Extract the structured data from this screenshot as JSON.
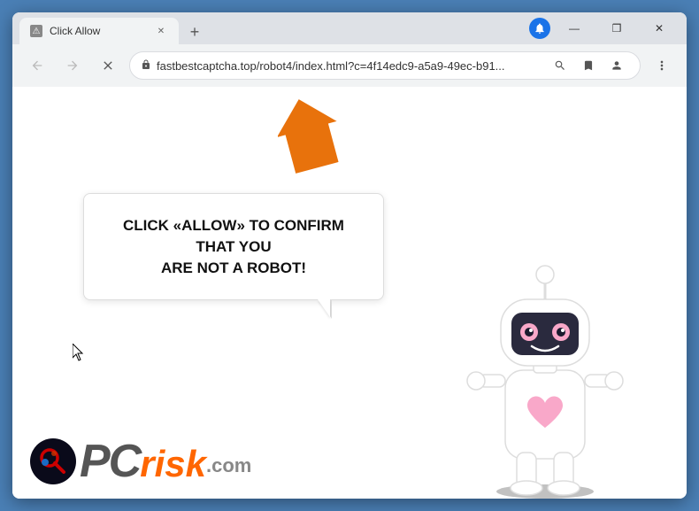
{
  "browser": {
    "tab": {
      "title": "Click Allow",
      "favicon": "⚠"
    },
    "new_tab_label": "+",
    "window_controls": {
      "minimize": "—",
      "maximize": "❒",
      "close": "✕"
    },
    "notification_icon": "🔔"
  },
  "navbar": {
    "back_label": "←",
    "forward_label": "→",
    "reload_label": "✕",
    "url": "fastbestcaptcha.top/robot4/index.html?c=4f14edc9-a5a9-49ec-b91...",
    "lock_icon": "🔒",
    "search_icon": "🔍",
    "bookmark_icon": "☆",
    "profile_icon": "👤",
    "menu_icon": "⋮"
  },
  "page": {
    "bubble_text_line1": "CLICK «ALLOW» TO CONFIRM THAT YOU",
    "bubble_text_line2": "ARE NOT A ROBOT!"
  },
  "logo": {
    "pc_text": "PC",
    "risk_text": "risk",
    "com_text": ".com"
  }
}
